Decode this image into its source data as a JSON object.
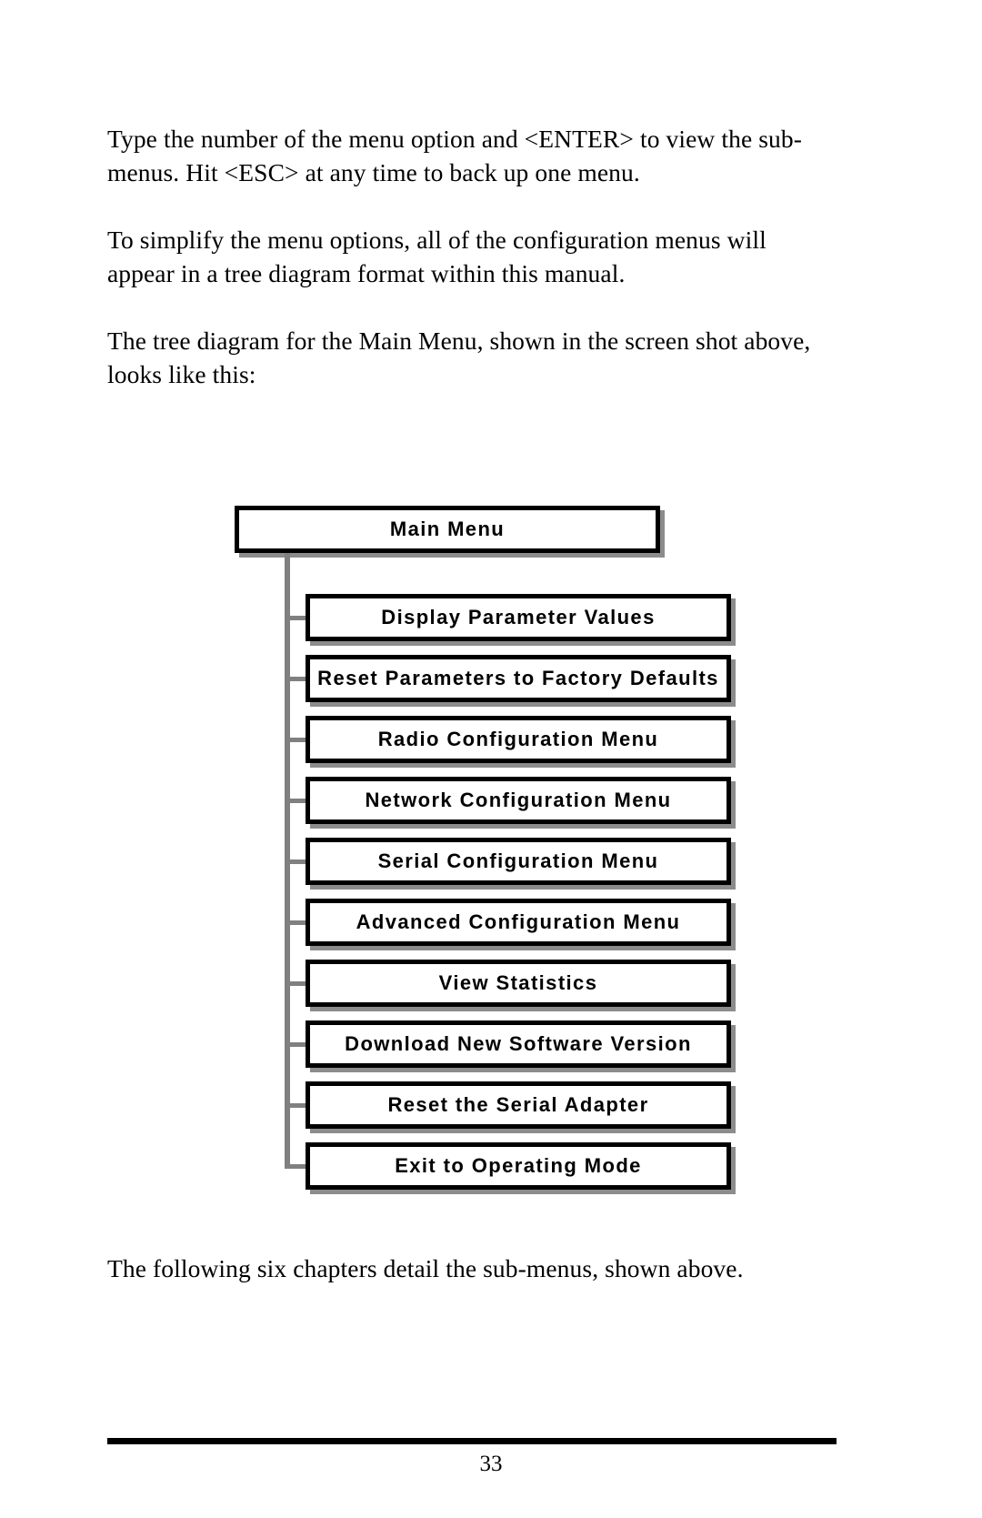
{
  "document": {
    "paragraphs": [
      "Type the number of the menu option and <ENTER> to view the sub-menus.  Hit <ESC> at any time to back up one menu.",
      "To simplify the menu options, all of the configuration menus will appear in a tree diagram format within this manual.",
      "The tree diagram for the Main Menu, shown in the screen shot above, looks like this:",
      "The following six chapters detail the sub-menus, shown above."
    ],
    "footer": {
      "page_number": "33"
    }
  },
  "tree": {
    "root": {
      "label": "Main Menu"
    },
    "children": [
      {
        "label": "Display Parameter Values"
      },
      {
        "label": "Reset Parameters to Factory Defaults"
      },
      {
        "label": "Radio Configuration Menu"
      },
      {
        "label": "Network Configuration Menu"
      },
      {
        "label": "Serial Configuration Menu"
      },
      {
        "label": "Advanced Configuration Menu"
      },
      {
        "label": "View Statistics"
      },
      {
        "label": "Download New Software Version"
      },
      {
        "label": "Reset the Serial Adapter"
      },
      {
        "label": "Exit to Operating Mode"
      }
    ],
    "colors": {
      "box_border": "#000000",
      "box_fill": "#ffffff",
      "box_shadow": "#8c8c8c",
      "connector": "#808080",
      "text": "#000000"
    }
  }
}
